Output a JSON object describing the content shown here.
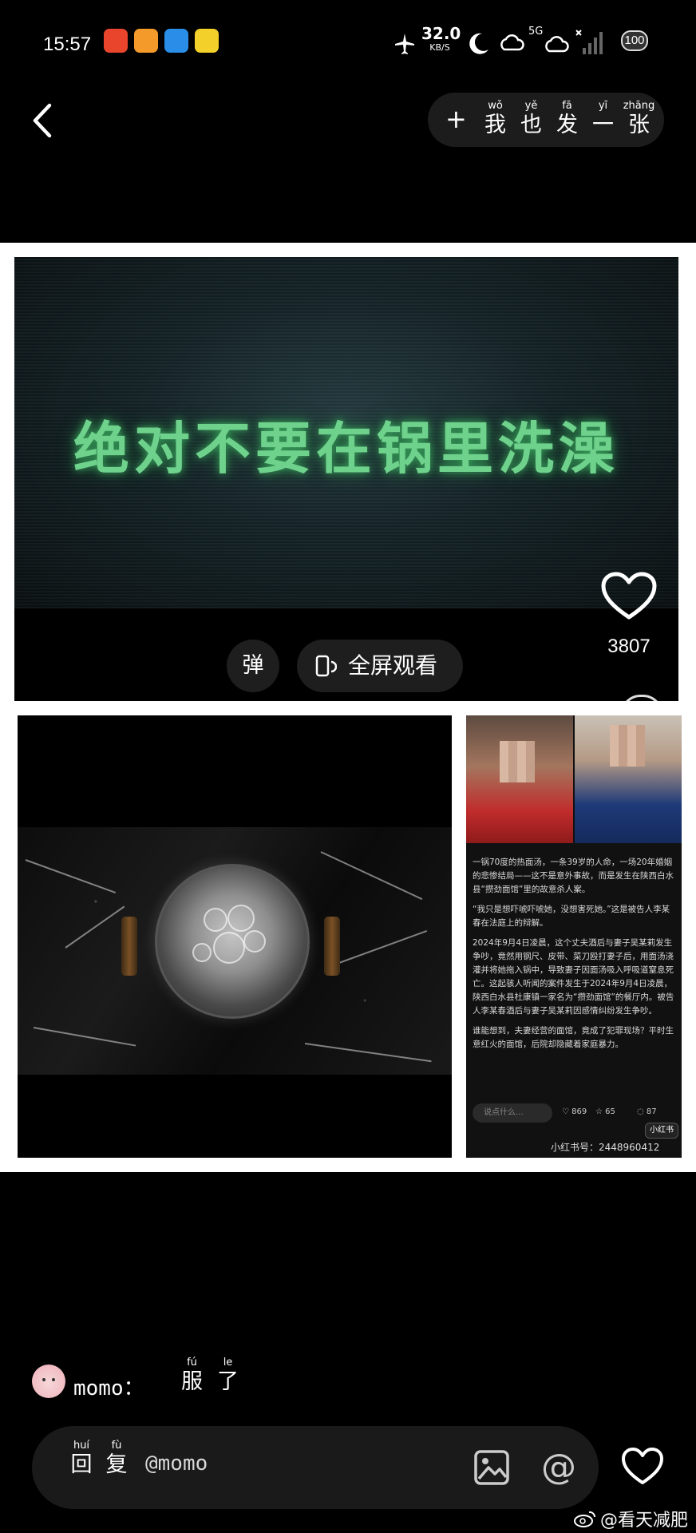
{
  "status_bar": {
    "time": "15:57",
    "net_speed_value": "32.0",
    "net_speed_unit": "KB/S",
    "network": "5G",
    "battery": "100"
  },
  "header": {
    "post_button": {
      "plus": "+",
      "label_chars": [
        {
          "hz": "我",
          "py": "wǒ"
        },
        {
          "hz": "也",
          "py": "yě"
        },
        {
          "hz": "发",
          "py": "fā"
        },
        {
          "hz": "一",
          "py": "yī"
        },
        {
          "hz": "张",
          "py": "zhāng"
        }
      ]
    }
  },
  "video": {
    "title_text": "绝对不要在锅里洗澡",
    "danmu_label": "弹",
    "fullscreen_label": "全屏观看",
    "like_count": "3807"
  },
  "news_image": {
    "paragraphs": [
      "一锅70度的热面汤，一条39岁的人命，一场20年婚姻的悲惨结局——这不是意外事故，而是发生在陕西白水县“攒劲面馆”里的故意杀人案。",
      "“我只是想吓唬吓唬她，没想害死她。”这是被告人李某春在法庭上的辩解。",
      "2024年9月4日凌晨，这个丈夫酒后与妻子吴某莉发生争吵，竟然用钢尺、皮带、菜刀殴打妻子后，用面汤浇灌并将她拖入锅中，导致妻子因面汤吸入呼吸道窒息死亡。这起骇人听闻的案件发生于2024年9月4日凌晨，陕西白水县杜康镇一家名为“攒劲面馆”的餐厅内。被告人李某春酒后与妻子吴某莉因感情纠纷发生争吵。",
      "谁能想到，夫妻经营的面馆，竟成了犯罪现场？平时生意红火的面馆，后院却隐藏着家庭暴力。"
    ],
    "input_placeholder": "说点什么...",
    "likes": "869",
    "favorites": "65",
    "comments": "87",
    "badge": "小红书",
    "id_text": "小红书号：2448960412"
  },
  "comment": {
    "user": "momo：",
    "text_chars": [
      {
        "hz": "服",
        "py": "fú"
      },
      {
        "hz": "了",
        "py": "le"
      }
    ]
  },
  "reply_bar": {
    "label_chars": [
      {
        "hz": "回",
        "py": "huí"
      },
      {
        "hz": "复",
        "py": "fù"
      }
    ],
    "mention": "@momo"
  },
  "watermark": {
    "text": "@看天减肥"
  },
  "colors": {
    "background": "#000000",
    "content_bg": "#ffffff",
    "video_title": "#6fd28c",
    "pill_bg": "#1e1e1e"
  }
}
